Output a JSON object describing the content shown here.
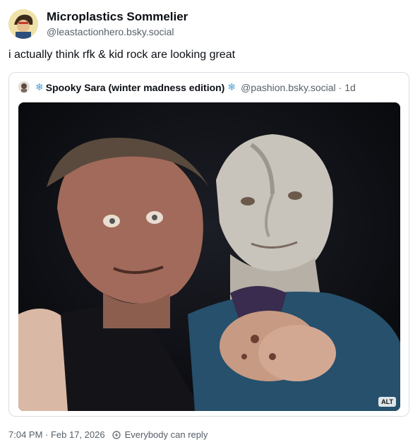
{
  "post": {
    "author_name": "Microplastics Sommelier",
    "author_handle": "@leastactionhero.bsky.social",
    "text": "i actually think rfk & kid rock are looking great",
    "timestamp": "7:04 PM · Feb 17, 2026",
    "reply_setting": "Everybody can reply"
  },
  "quote": {
    "author_name": "Spooky Sara (winter madness edition)",
    "author_handle": "@pashion.bsky.social",
    "age": "· 1d",
    "image_alt_badge": "ALT"
  },
  "icons": {
    "snowflake": "snowflake-icon",
    "reply": "globe-reply-icon"
  }
}
